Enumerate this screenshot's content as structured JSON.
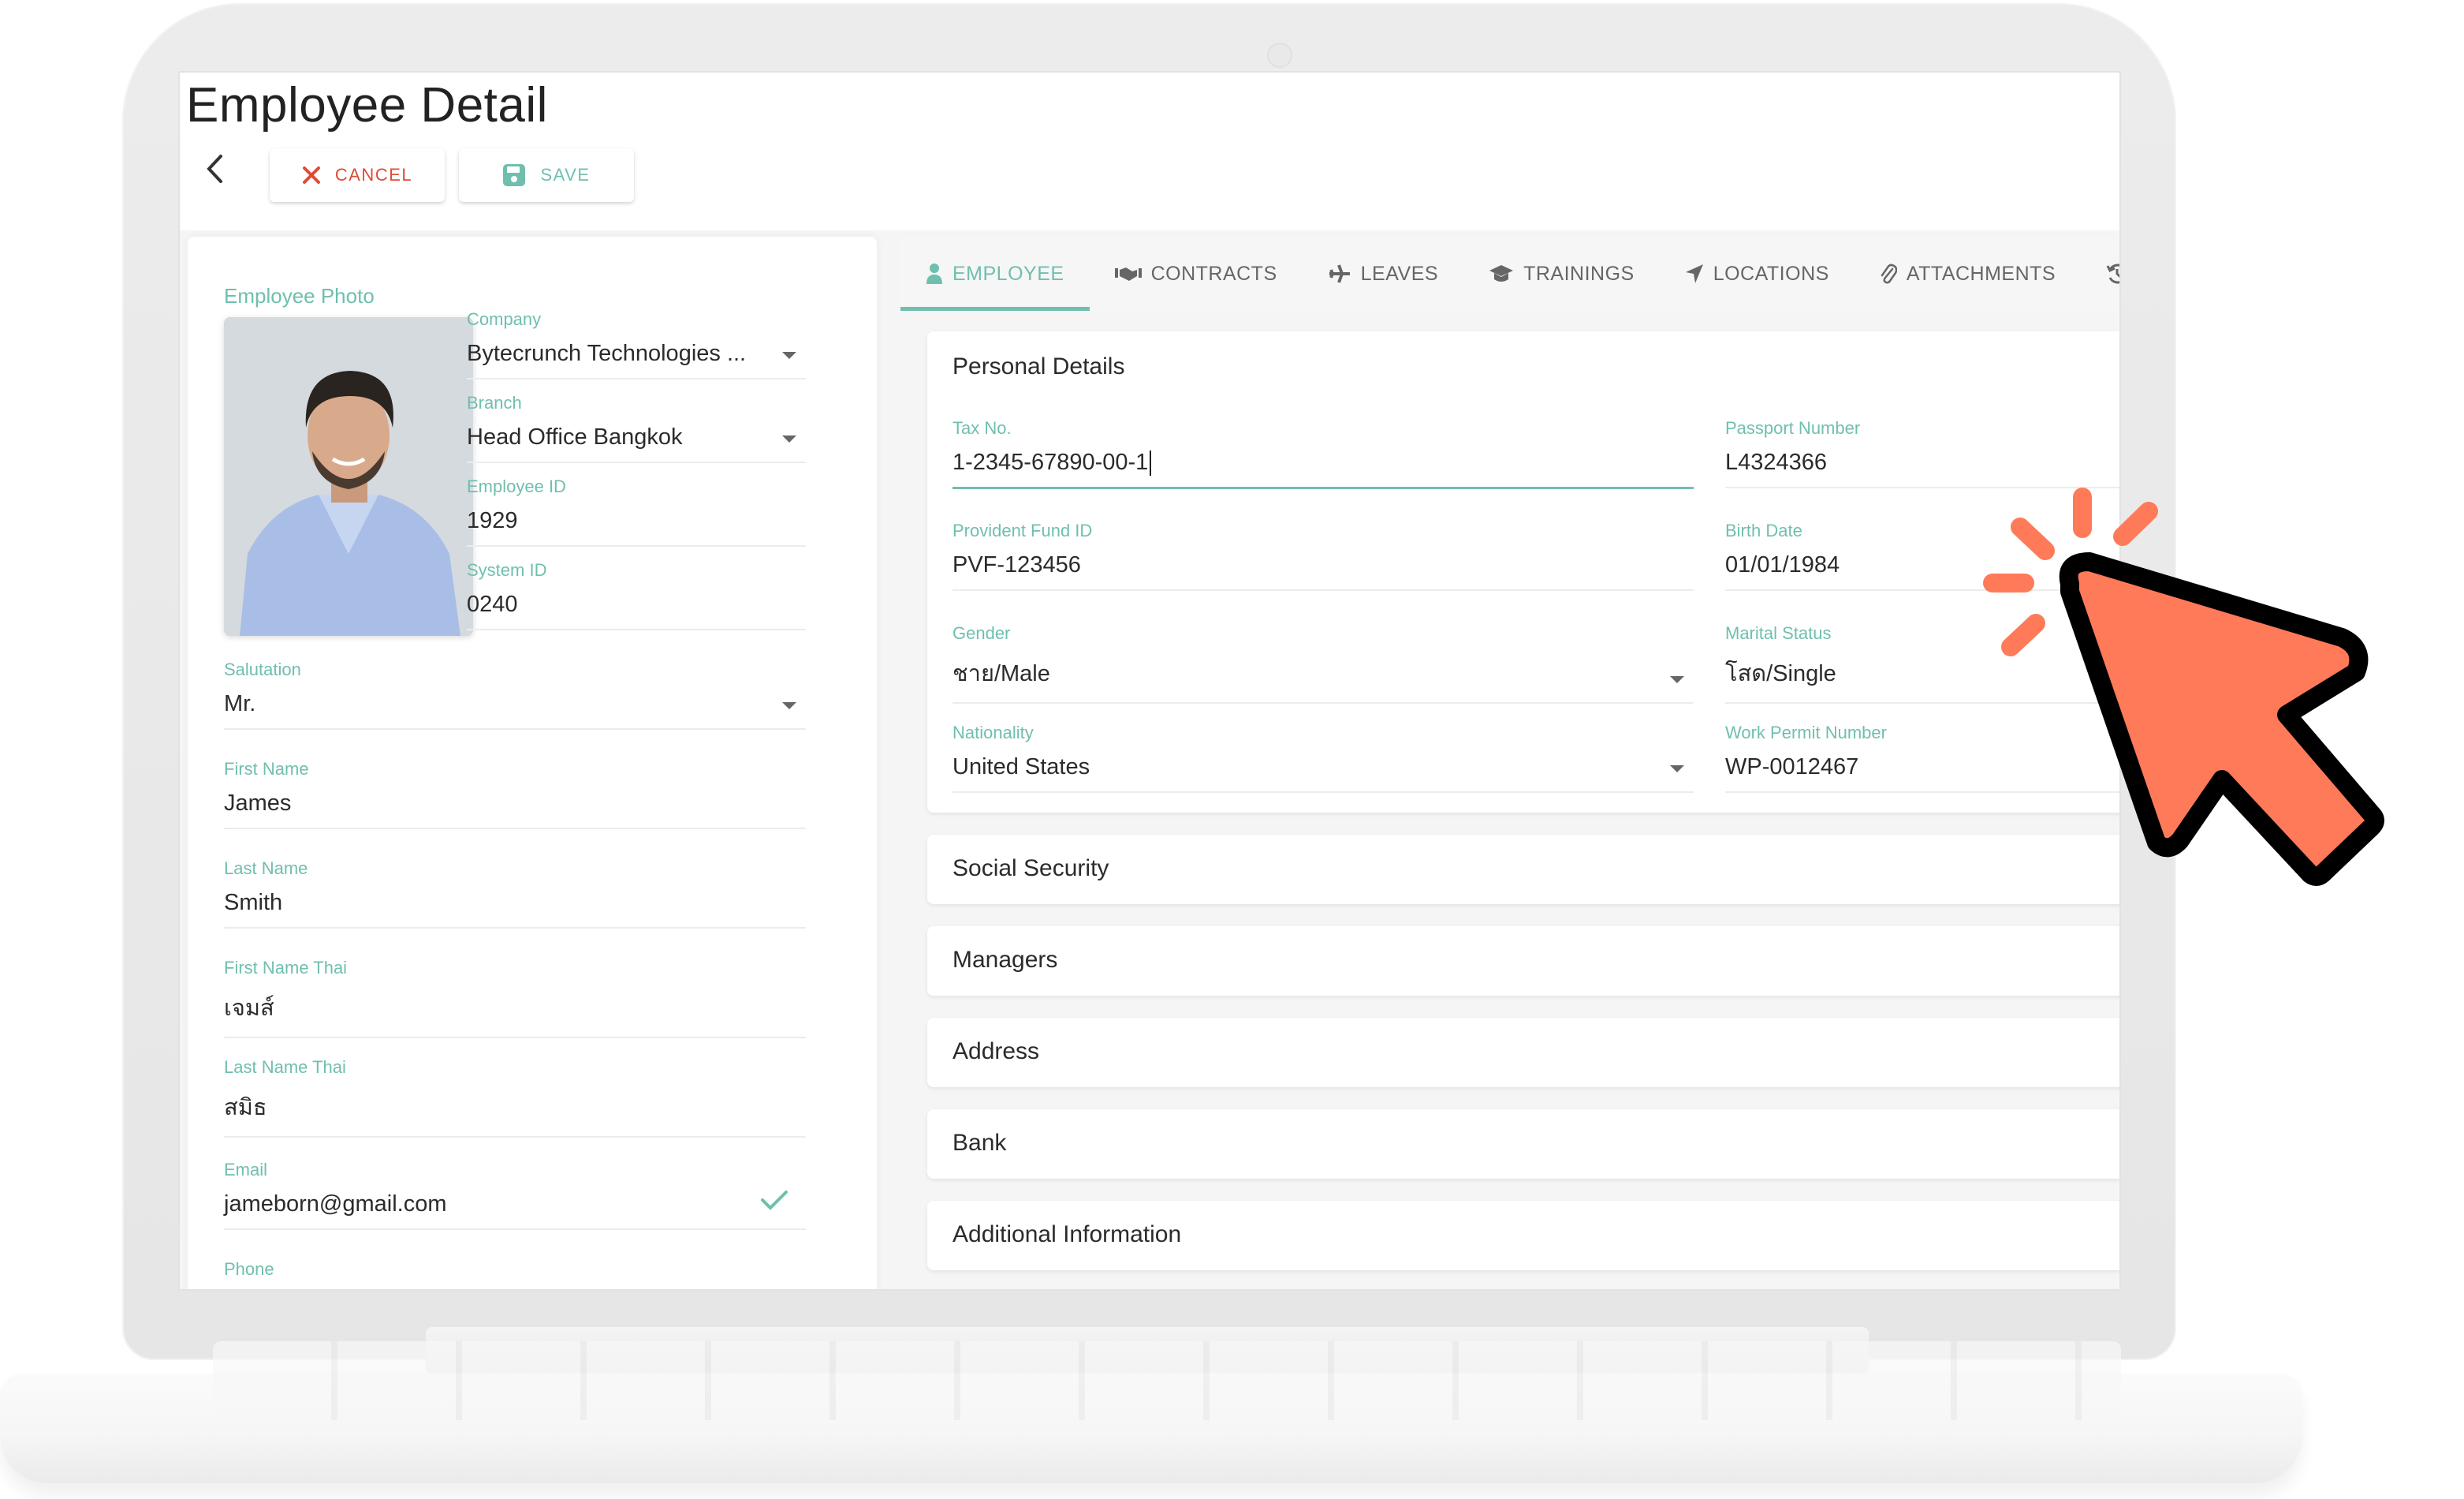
{
  "page": {
    "title": "Employee Detail",
    "cancel_label": "CANCEL",
    "save_label": "SAVE"
  },
  "colors": {
    "accent": "#6fbfae",
    "danger": "#e04a35",
    "pointer_fill": "#ff7a59",
    "pointer_outline": "#000000"
  },
  "left_panel": {
    "photo_label": "Employee Photo",
    "company": {
      "label": "Company",
      "value": "Bytecrunch Technologies ..."
    },
    "branch": {
      "label": "Branch",
      "value": "Head Office Bangkok"
    },
    "employee_id": {
      "label": "Employee ID",
      "value": "1929"
    },
    "system_id": {
      "label": "System ID",
      "value": "0240"
    },
    "salutation": {
      "label": "Salutation",
      "value": "Mr."
    },
    "first_name": {
      "label": "First Name",
      "value": "James"
    },
    "last_name": {
      "label": "Last Name",
      "value": "Smith"
    },
    "first_name_thai": {
      "label": "First Name Thai",
      "value": "เจมส์"
    },
    "last_name_thai": {
      "label": "Last Name Thai",
      "value": "สมิธ"
    },
    "email": {
      "label": "Email",
      "value": "jameborn@gmail.com"
    },
    "phone": {
      "label": "Phone"
    }
  },
  "tabs": [
    {
      "label": "EMPLOYEE",
      "icon": "user-icon",
      "active": true
    },
    {
      "label": "CONTRACTS",
      "icon": "handshake-icon"
    },
    {
      "label": "LEAVES",
      "icon": "plane-icon"
    },
    {
      "label": "TRAININGS",
      "icon": "graduation-cap-icon"
    },
    {
      "label": "LOCATIONS",
      "icon": "location-arrow-icon"
    },
    {
      "label": "ATTACHMENTS",
      "icon": "paperclip-icon"
    },
    {
      "label": "",
      "icon": "history-icon"
    }
  ],
  "personal_details": {
    "title": "Personal Details",
    "tax_no": {
      "label": "Tax No.",
      "value": "1-2345-67890-00-1"
    },
    "passport_number": {
      "label": "Passport Number",
      "value": "L4324366"
    },
    "provident_fund_id": {
      "label": "Provident Fund ID",
      "value": "PVF-123456"
    },
    "birth_date": {
      "label": "Birth Date",
      "value": "01/01/1984"
    },
    "gender": {
      "label": "Gender",
      "value": "ชาย/Male"
    },
    "marital_status": {
      "label": "Marital Status",
      "value": "โสด/Single"
    },
    "nationality": {
      "label": "Nationality",
      "value": "United States"
    },
    "work_permit_number": {
      "label": "Work Permit Number",
      "value": "WP-0012467"
    }
  },
  "sections": [
    "Social Security",
    "Managers",
    "Address",
    "Bank",
    "Additional Information"
  ]
}
